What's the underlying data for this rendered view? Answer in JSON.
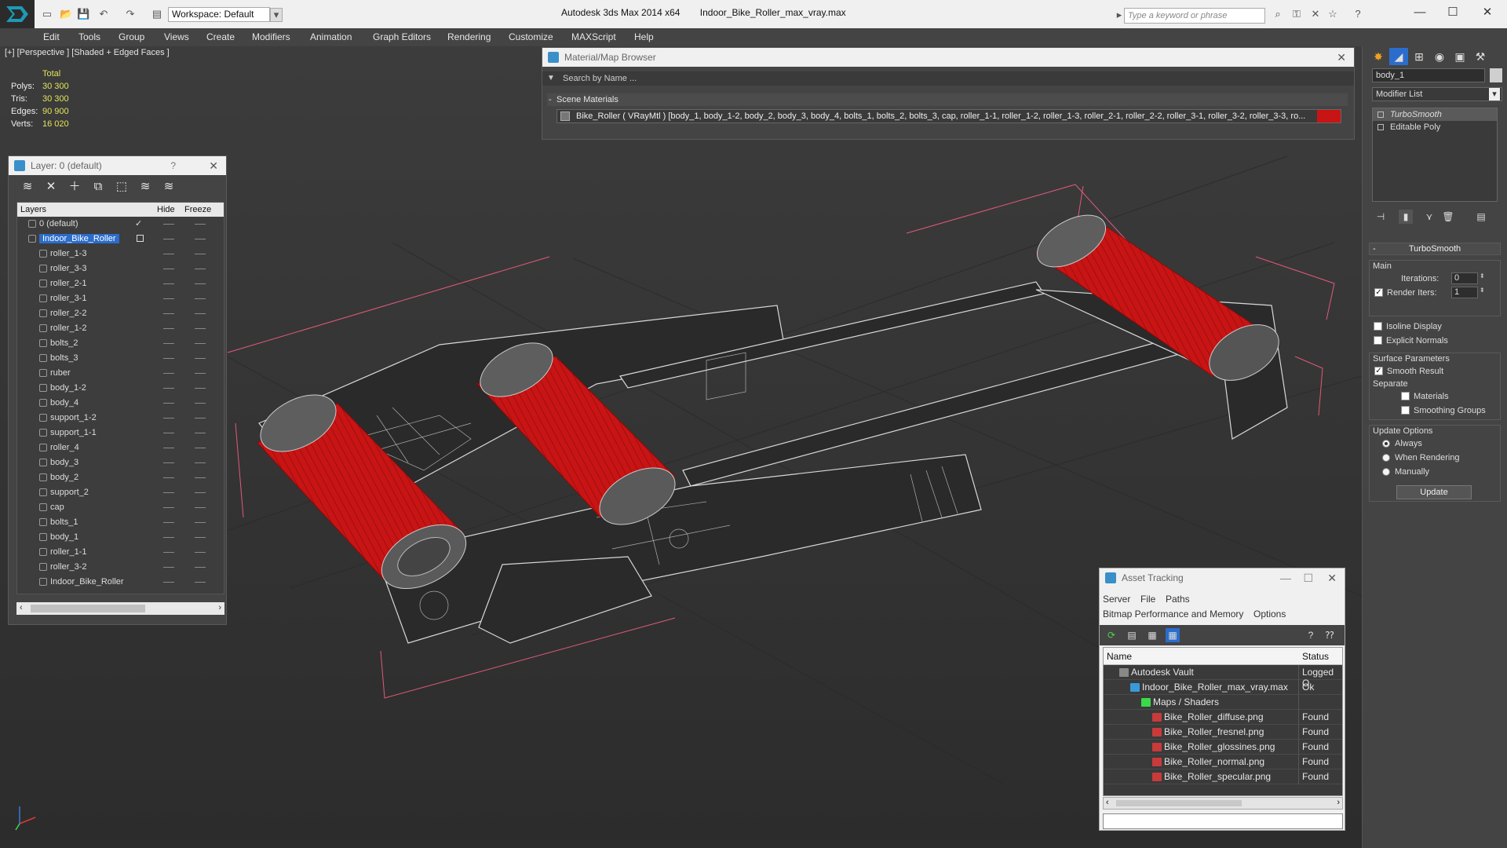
{
  "titlebar": {
    "workspace": "Workspace: Default",
    "app_name": "Autodesk 3ds Max  2014 x64",
    "file_name": "Indoor_Bike_Roller_max_vray.max",
    "search_placeholder": "Type a keyword or phrase"
  },
  "menu": [
    "Edit",
    "Tools",
    "Group",
    "Views",
    "Create",
    "Modifiers",
    "Animation",
    "Graph Editors",
    "Rendering",
    "Customize",
    "MAXScript",
    "Help"
  ],
  "viewport": {
    "label": "[+] [Perspective ] [Shaded + Edged Faces ]",
    "stats": {
      "header": "Total",
      "polys_label": "Polys:",
      "polys": "30 300",
      "tris_label": "Tris:",
      "tris": "30 300",
      "edges_label": "Edges:",
      "edges": "90 900",
      "verts_label": "Verts:",
      "verts": "16 020"
    },
    "roller_color": "#c81414",
    "frame_color": "#2a2a2a",
    "bbox_color": "#e05a7a"
  },
  "layer_panel": {
    "title": "Layer: 0 (default)",
    "help": "?",
    "columns": {
      "layers": "Layers",
      "hide": "Hide",
      "freeze": "Freeze"
    },
    "rows": [
      {
        "name": "0 (default)",
        "level": 1,
        "check": "✓"
      },
      {
        "name": "Indoor_Bike_Roller",
        "level": 1,
        "selected": true
      },
      {
        "name": "roller_1-3",
        "level": 2
      },
      {
        "name": "roller_3-3",
        "level": 2
      },
      {
        "name": "roller_2-1",
        "level": 2
      },
      {
        "name": "roller_3-1",
        "level": 2
      },
      {
        "name": "roller_2-2",
        "level": 2
      },
      {
        "name": "roller_1-2",
        "level": 2
      },
      {
        "name": "bolts_2",
        "level": 2
      },
      {
        "name": "bolts_3",
        "level": 2
      },
      {
        "name": "ruber",
        "level": 2
      },
      {
        "name": "body_1-2",
        "level": 2
      },
      {
        "name": "body_4",
        "level": 2
      },
      {
        "name": "support_1-2",
        "level": 2
      },
      {
        "name": "support_1-1",
        "level": 2
      },
      {
        "name": "roller_4",
        "level": 2
      },
      {
        "name": "body_3",
        "level": 2
      },
      {
        "name": "body_2",
        "level": 2
      },
      {
        "name": "support_2",
        "level": 2
      },
      {
        "name": "cap",
        "level": 2
      },
      {
        "name": "bolts_1",
        "level": 2
      },
      {
        "name": "body_1",
        "level": 2
      },
      {
        "name": "roller_1-1",
        "level": 2
      },
      {
        "name": "roller_3-2",
        "level": 2
      },
      {
        "name": "Indoor_Bike_Roller",
        "level": 2
      }
    ]
  },
  "material_browser": {
    "title": "Material/Map Browser",
    "search_placeholder": "Search by Name ...",
    "section": "Scene Materials",
    "entry": "Bike_Roller  ( VRayMtl )  [body_1, body_1-2, body_2, body_3, body_4, bolts_1, bolts_2, bolts_3, cap, roller_1-1, roller_1-2, roller_1-3, roller_2-1, roller_2-2, roller_3-1, roller_3-2, roller_3-3, ro..."
  },
  "command_panel": {
    "object_name": "body_1",
    "modifier_list": "Modifier List",
    "stack": [
      {
        "name": "TurboSmooth",
        "selected": true
      },
      {
        "name": "Editable Poly",
        "selected": false
      }
    ],
    "turbosmooth": {
      "title": "TurboSmooth",
      "main": "Main",
      "iterations_label": "Iterations:",
      "iterations": "0",
      "render_iters_label": "Render Iters:",
      "render_iters": "1",
      "render_iters_checked": true,
      "isoline": "Isoline Display",
      "explicit_normals": "Explicit Normals",
      "surface_params": "Surface Parameters",
      "smooth_result": "Smooth Result",
      "separate": "Separate",
      "materials": "Materials",
      "smoothing_groups": "Smoothing Groups",
      "update_options": "Update Options",
      "always": "Always",
      "when_rendering": "When Rendering",
      "manually": "Manually",
      "update_button": "Update"
    }
  },
  "asset_tracking": {
    "title": "Asset Tracking",
    "menu1": [
      "Server",
      "File",
      "Paths"
    ],
    "menu2": [
      "Bitmap Performance and Memory",
      "Options"
    ],
    "columns": {
      "name": "Name",
      "status": "Status"
    },
    "rows": [
      {
        "name": "Autodesk Vault",
        "status": "Logged O",
        "indent": 1,
        "icon": "vault-icon"
      },
      {
        "name": "Indoor_Bike_Roller_max_vray.max",
        "status": "Ok",
        "indent": 2,
        "icon": "max-file-icon"
      },
      {
        "name": "Maps / Shaders",
        "status": "",
        "indent": 3,
        "icon": "maps-folder-icon"
      },
      {
        "name": "Bike_Roller_diffuse.png",
        "status": "Found",
        "indent": 4,
        "icon": "png-icon"
      },
      {
        "name": "Bike_Roller_fresnel.png",
        "status": "Found",
        "indent": 4,
        "icon": "png-icon"
      },
      {
        "name": "Bike_Roller_glossines.png",
        "status": "Found",
        "indent": 4,
        "icon": "png-icon"
      },
      {
        "name": "Bike_Roller_normal.png",
        "status": "Found",
        "indent": 4,
        "icon": "png-icon"
      },
      {
        "name": "Bike_Roller_specular.png",
        "status": "Found",
        "indent": 4,
        "icon": "png-icon"
      }
    ]
  }
}
